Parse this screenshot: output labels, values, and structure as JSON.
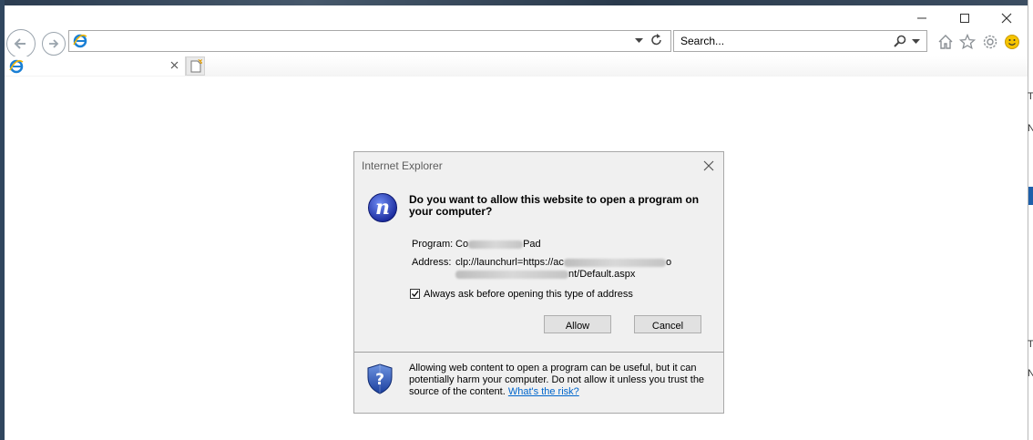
{
  "browser": {
    "address_value": "",
    "search_placeholder": "Search...",
    "tab_title": ""
  },
  "dialog": {
    "title": "Internet Explorer",
    "heading": "Do you want to allow this website to open a program on your computer?",
    "program_label": "Program:",
    "program_value_visible": "Co",
    "program_value_tail": "Pad",
    "address_label": "Address:",
    "address_line1": "clp://launchurl=https://ac",
    "address_line1_tail": "o",
    "address_line2_tail": "nt/Default.aspx",
    "checkbox_label": "Always ask before opening this type of address",
    "checkbox_checked": true,
    "allow_label": "Allow",
    "cancel_label": "Cancel",
    "info_text": "Allowing web content to open a program can be useful, but it can potentially harm your computer. Do not allow it unless you trust the source of the content.",
    "risk_link": "What's the risk?"
  },
  "side_peek": {
    "letters": [
      "T",
      "N",
      "T",
      "N"
    ]
  },
  "colors": {
    "accent_blue": "#1e5faa",
    "link": "#0066cc",
    "dialog_bg": "#f0f0f0"
  }
}
